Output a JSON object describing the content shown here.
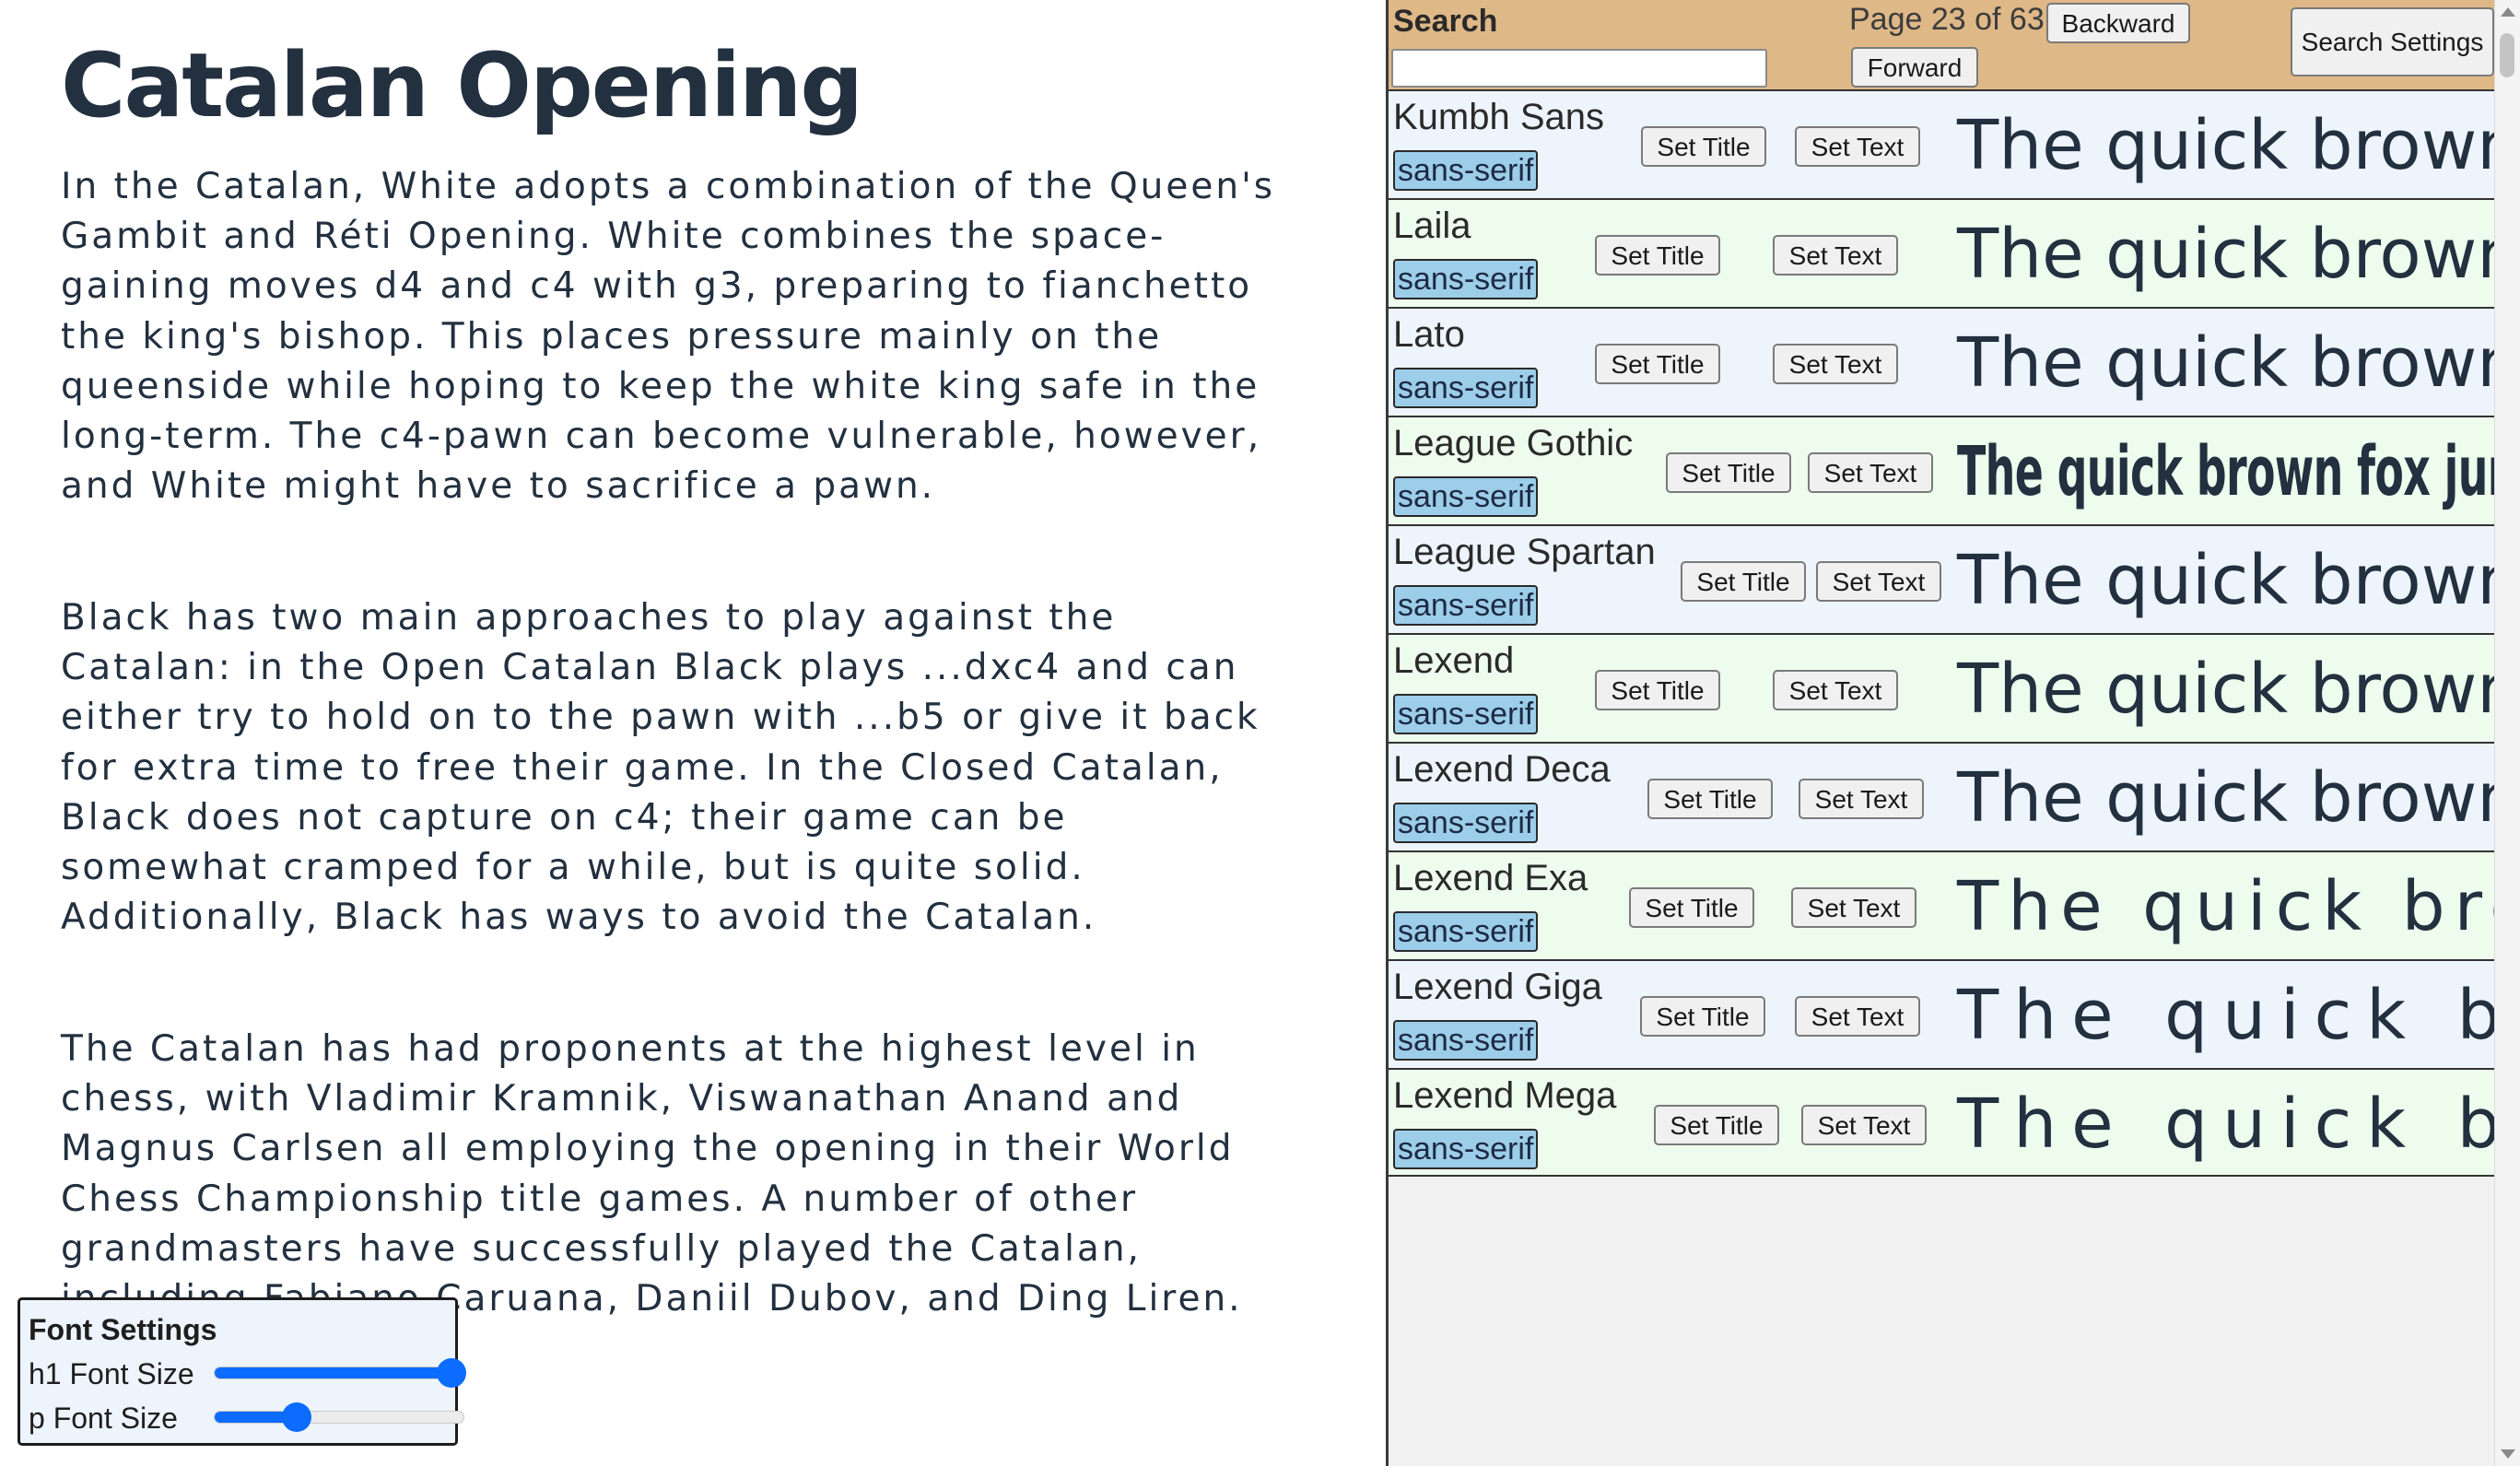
{
  "article": {
    "title": "Catalan Opening",
    "paragraphs": [
      "In the Catalan, White adopts a combination of the Queen's Gambit and Réti Opening. White combines the space-gaining moves d4 and c4 with g3, preparing to fianchetto the king's bishop. This places pressure mainly on the queenside while hoping to keep the white king safe in the long-term. The c4-pawn can become vulnerable, however, and White might have to sacrifice a pawn.",
      "Black has two main approaches to play against the Catalan: in the Open Catalan Black plays ...dxc4 and can either try to hold on to the pawn with ...b5 or give it back for extra time to free their game. In the Closed Catalan, Black does not capture on c4; their game can be somewhat cramped for a while, but is quite solid. Additionally, Black has ways to avoid the Catalan.",
      "The Catalan has had proponents at the highest level in chess, with Vladimir Kramnik, Viswanathan Anand and Magnus Carlsen all employing the opening in their World Chess Championship title games. A number of other grandmasters have successfully played the Catalan, including Fabiano Caruana, Daniil Dubov, and Ding Liren."
    ]
  },
  "font_settings": {
    "title": "Font Settings",
    "h1_label": "h1 Font Size",
    "p_label": "p Font Size",
    "h1_value_fraction": 0.95,
    "p_value_fraction": 0.33,
    "accent_color": "#0b6cff"
  },
  "search": {
    "label": "Search",
    "input_value": "",
    "page_text": "Page 23 of 63",
    "backward_label": "Backward",
    "forward_label": "Forward",
    "settings_label": "Search Settings",
    "header_color": "#deb887"
  },
  "font_list": {
    "set_title_label": "Set Title",
    "set_text_label": "Set Text",
    "sample_text": "The quick brown fox jumped over the lazy dog",
    "row_colors": [
      "#eef4fb",
      "#eefcee"
    ],
    "badge_color": "#9ccde9",
    "fonts": [
      {
        "name": "Kumbh Sans",
        "category": "sans-serif"
      },
      {
        "name": "Laila",
        "category": "sans-serif"
      },
      {
        "name": "Lato",
        "category": "sans-serif"
      },
      {
        "name": "League Gothic",
        "category": "sans-serif"
      },
      {
        "name": "League Spartan",
        "category": "sans-serif"
      },
      {
        "name": "Lexend",
        "category": "sans-serif"
      },
      {
        "name": "Lexend Deca",
        "category": "sans-serif"
      },
      {
        "name": "Lexend Exa",
        "category": "sans-serif"
      },
      {
        "name": "Lexend Giga",
        "category": "sans-serif"
      },
      {
        "name": "Lexend Mega",
        "category": "sans-serif"
      }
    ]
  }
}
